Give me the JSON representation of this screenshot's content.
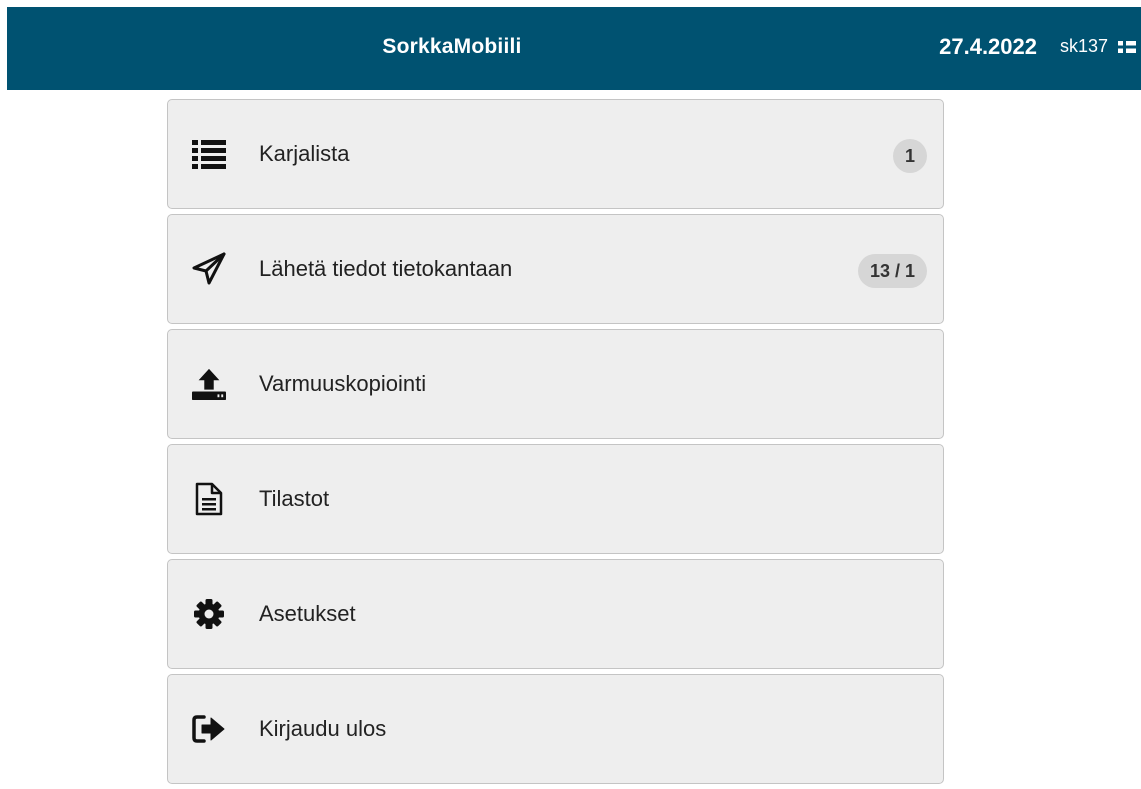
{
  "header": {
    "title": "SorkkaMobiili",
    "date": "27.4.2022",
    "user": "sk137",
    "flag_icon": "finland-flag-icon",
    "background_color": "#005271"
  },
  "menu": {
    "items": [
      {
        "label": "Karjalista",
        "icon": "list-icon",
        "badge": "1"
      },
      {
        "label": "Lähetä tiedot tietokantaan",
        "icon": "paper-plane-icon",
        "badge": "13 / 1"
      },
      {
        "label": "Varmuuskopiointi",
        "icon": "upload-icon"
      },
      {
        "label": "Tilastot",
        "icon": "document-icon"
      },
      {
        "label": "Asetukset",
        "icon": "gear-icon"
      },
      {
        "label": "Kirjaudu ulos",
        "icon": "sign-out-icon"
      }
    ]
  }
}
